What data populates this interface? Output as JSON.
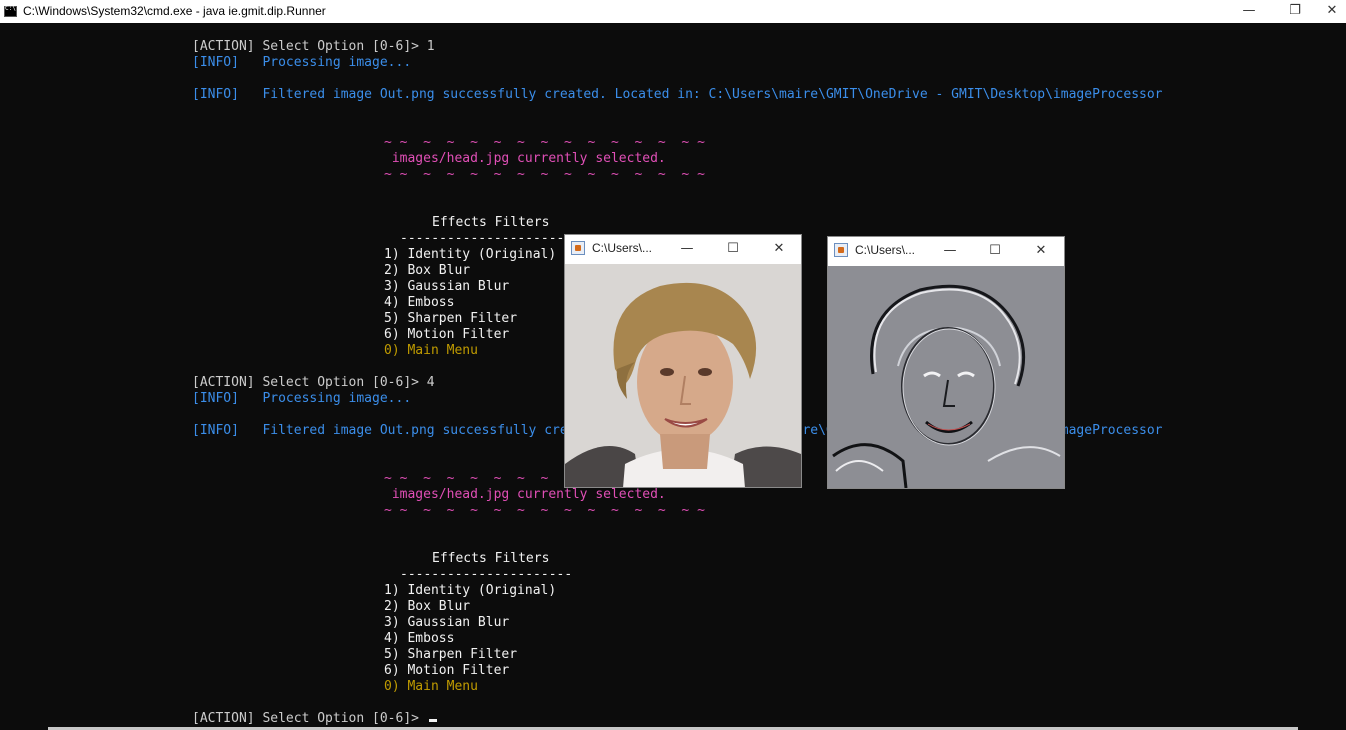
{
  "window": {
    "title": "C:\\Windows\\System32\\cmd.exe - java  ie.gmit.dip.Runner",
    "icon": "cmd-icon",
    "minimize": "—",
    "restore": "❐",
    "close": "✕"
  },
  "console": {
    "block1": {
      "action": "[ACTION] Select Option [0-6]> 1",
      "info_processing": "[INFO]   Processing image...",
      "info_filtered": "[INFO]   Filtered image Out.png successfully created. Located in: C:\\Users\\maire\\GMIT\\OneDrive - GMIT\\Desktop\\imageProcessor"
    },
    "banner1": {
      "tilde_top": "~ ~  ~  ~  ~  ~  ~  ~  ~  ~  ~  ~  ~  ~ ~",
      "selected": " images/head.jpg currently selected.",
      "tilde_bottom": "~ ~  ~  ~  ~  ~  ~  ~  ~  ~  ~  ~  ~  ~ ~"
    },
    "menu1": {
      "heading": "Effects Filters",
      "rule": "----------------------",
      "items": [
        "1) Identity (Original)",
        "2) Box Blur",
        "3) Gaussian Blur",
        "4) Emboss",
        "5) Sharpen Filter",
        "6) Motion Filter"
      ],
      "main_menu": "0) Main Menu"
    },
    "block2": {
      "action": "[ACTION] Select Option [0-6]> 4",
      "info_processing": "[INFO]   Processing image...",
      "info_filtered": "[INFO]   Filtered image Out.png successfully created. Located in: C:\\Users\\maire\\GMIT\\OneDrive - GMIT\\Desktop\\imageProcessor"
    },
    "banner2": {
      "tilde_top": "~ ~  ~  ~  ~  ~  ~  ~  ~  ~  ~  ~  ~  ~ ~",
      "selected": " images/head.jpg currently selected.",
      "tilde_bottom": "~ ~  ~  ~  ~  ~  ~  ~  ~  ~  ~  ~  ~  ~ ~"
    },
    "menu2": {
      "heading": "Effects Filters",
      "rule": "----------------------",
      "items": [
        "1) Identity (Original)",
        "2) Box Blur",
        "3) Gaussian Blur",
        "4) Emboss",
        "5) Sharpen Filter",
        "6) Motion Filter"
      ],
      "main_menu": "0) Main Menu"
    },
    "prompt": "[ACTION] Select Option [0-6]> "
  },
  "image_windows": [
    {
      "title": "C:\\Users\\...",
      "minimize": "—",
      "maximize": "☐",
      "close": "✕",
      "content": "original-portrait"
    },
    {
      "title": "C:\\Users\\...",
      "minimize": "—",
      "maximize": "☐",
      "close": "✕",
      "content": "emboss-portrait"
    }
  ],
  "colors": {
    "background": "#0c0c0c",
    "text": "#cccccc",
    "info": "#3b8eea",
    "banner": "#e04fb6",
    "main_menu": "#c19c00"
  }
}
